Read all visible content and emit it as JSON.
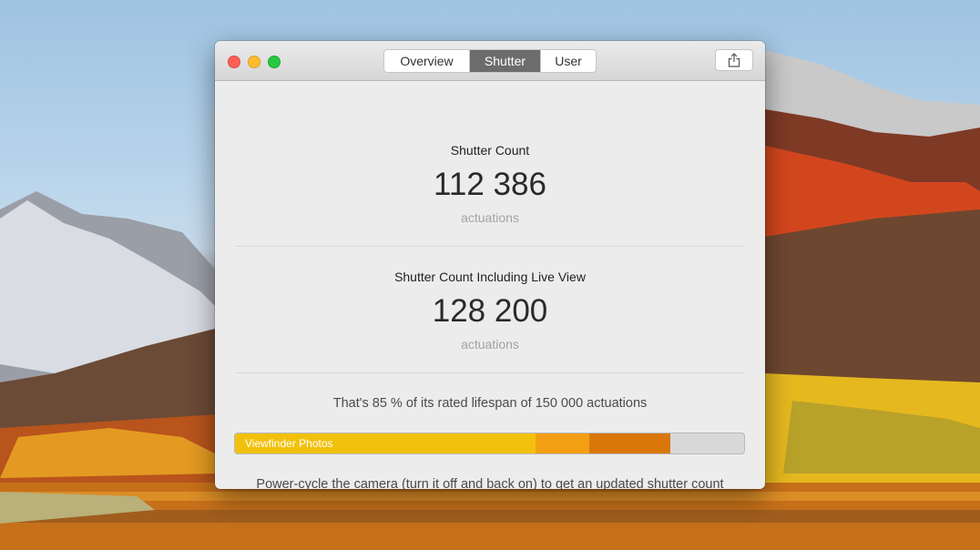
{
  "tabs": [
    {
      "label": "Overview",
      "selected": false
    },
    {
      "label": "Shutter",
      "selected": true
    },
    {
      "label": "User",
      "selected": false
    }
  ],
  "shutter_count": {
    "title": "Shutter Count",
    "value": "112 386",
    "unit": "actuations"
  },
  "shutter_count_live": {
    "title": "Shutter Count Including Live View",
    "value": "128 200",
    "unit": "actuations"
  },
  "lifespan_text": "That's 85 % of its rated lifespan of 150 000 actuations",
  "progress": {
    "label": "Viewfinder Photos",
    "segments": [
      {
        "fraction": 0.59,
        "color": "#f2c10d"
      },
      {
        "fraction": 0.105,
        "color": "#f29f14"
      },
      {
        "fraction": 0.16,
        "color": "#d9770b"
      }
    ],
    "track_color": "#d8d8d8"
  },
  "note": "Power-cycle the camera (turn it off and back on) to get an updated shutter count reading.",
  "icons": {
    "share": "share-icon"
  }
}
